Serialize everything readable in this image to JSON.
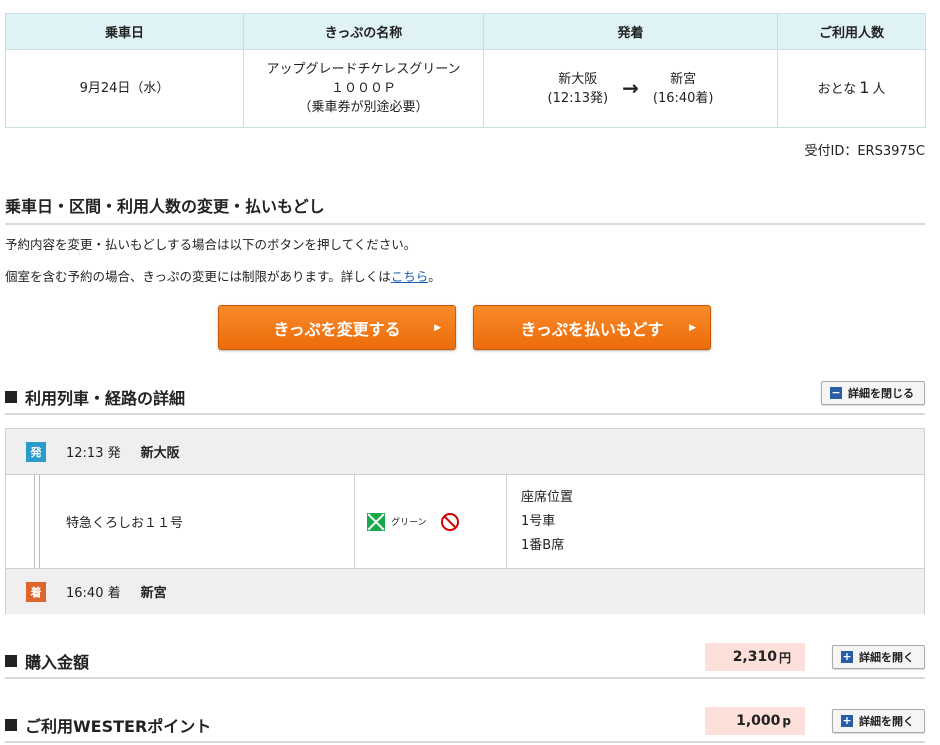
{
  "summary": {
    "headers": [
      "乗車日",
      "きっぷの名称",
      "発着",
      "ご利用人数"
    ],
    "date": "9月24日（水）",
    "ticket_name_line1": "アップグレードチケレスグリーン",
    "ticket_name_line2": "１０００Ｐ",
    "ticket_name_line3": "（乗車券が別途必要）",
    "from_station": "新大阪",
    "from_time": "(12:13発)",
    "arrow": "→",
    "to_station": "新宮",
    "to_time": "(16:40着)",
    "pax_prefix": "おとな",
    "pax_count": "1",
    "pax_suffix": "人"
  },
  "receipt_id": "受付ID：ERS3975C",
  "change_section": {
    "title": "乗車日・区間・利用人数の変更・払いもどし",
    "text1": "予約内容を変更・払いもどしする場合は以下のボタンを押してください。",
    "text2_prefix": "個室を含む予約の場合、きっぷの変更には制限があります。詳しくは",
    "text2_link": "こちら",
    "text2_suffix": "。",
    "change_button": "きっぷを変更する",
    "refund_button": "きっぷを払いもどす",
    "chevron": "▶"
  },
  "route_section": {
    "title": "利用列車・経路の詳細",
    "toggle_label": "詳細を閉じる",
    "toggle_symbol": "−",
    "departure": {
      "badge": "発",
      "time": "12:13 発",
      "station": "新大阪"
    },
    "train": {
      "name": "特急くろしお１１号",
      "car_class": "グリーン",
      "seat_label": "座席位置",
      "car": "1号車",
      "seat": "1番B席"
    },
    "arrival": {
      "badge": "着",
      "time": "16:40 着",
      "station": "新宮"
    }
  },
  "purchase_section": {
    "title": "購入金額",
    "amount": "2,310",
    "unit": "円",
    "toggle_label": "詳細を開く",
    "toggle_symbol": "+"
  },
  "points_section": {
    "title": "ご利用WESTERポイント",
    "amount": "1,000",
    "unit": "p",
    "toggle_label": "詳細を開く",
    "toggle_symbol": "+"
  },
  "colors": {
    "header_bg": "#dff2f5",
    "orange_button": "#ec6c0a",
    "dep_badge": "#2a9cc9",
    "arr_badge": "#e0652d",
    "price_bg": "#fde0da",
    "green_car": "#19a84a"
  }
}
